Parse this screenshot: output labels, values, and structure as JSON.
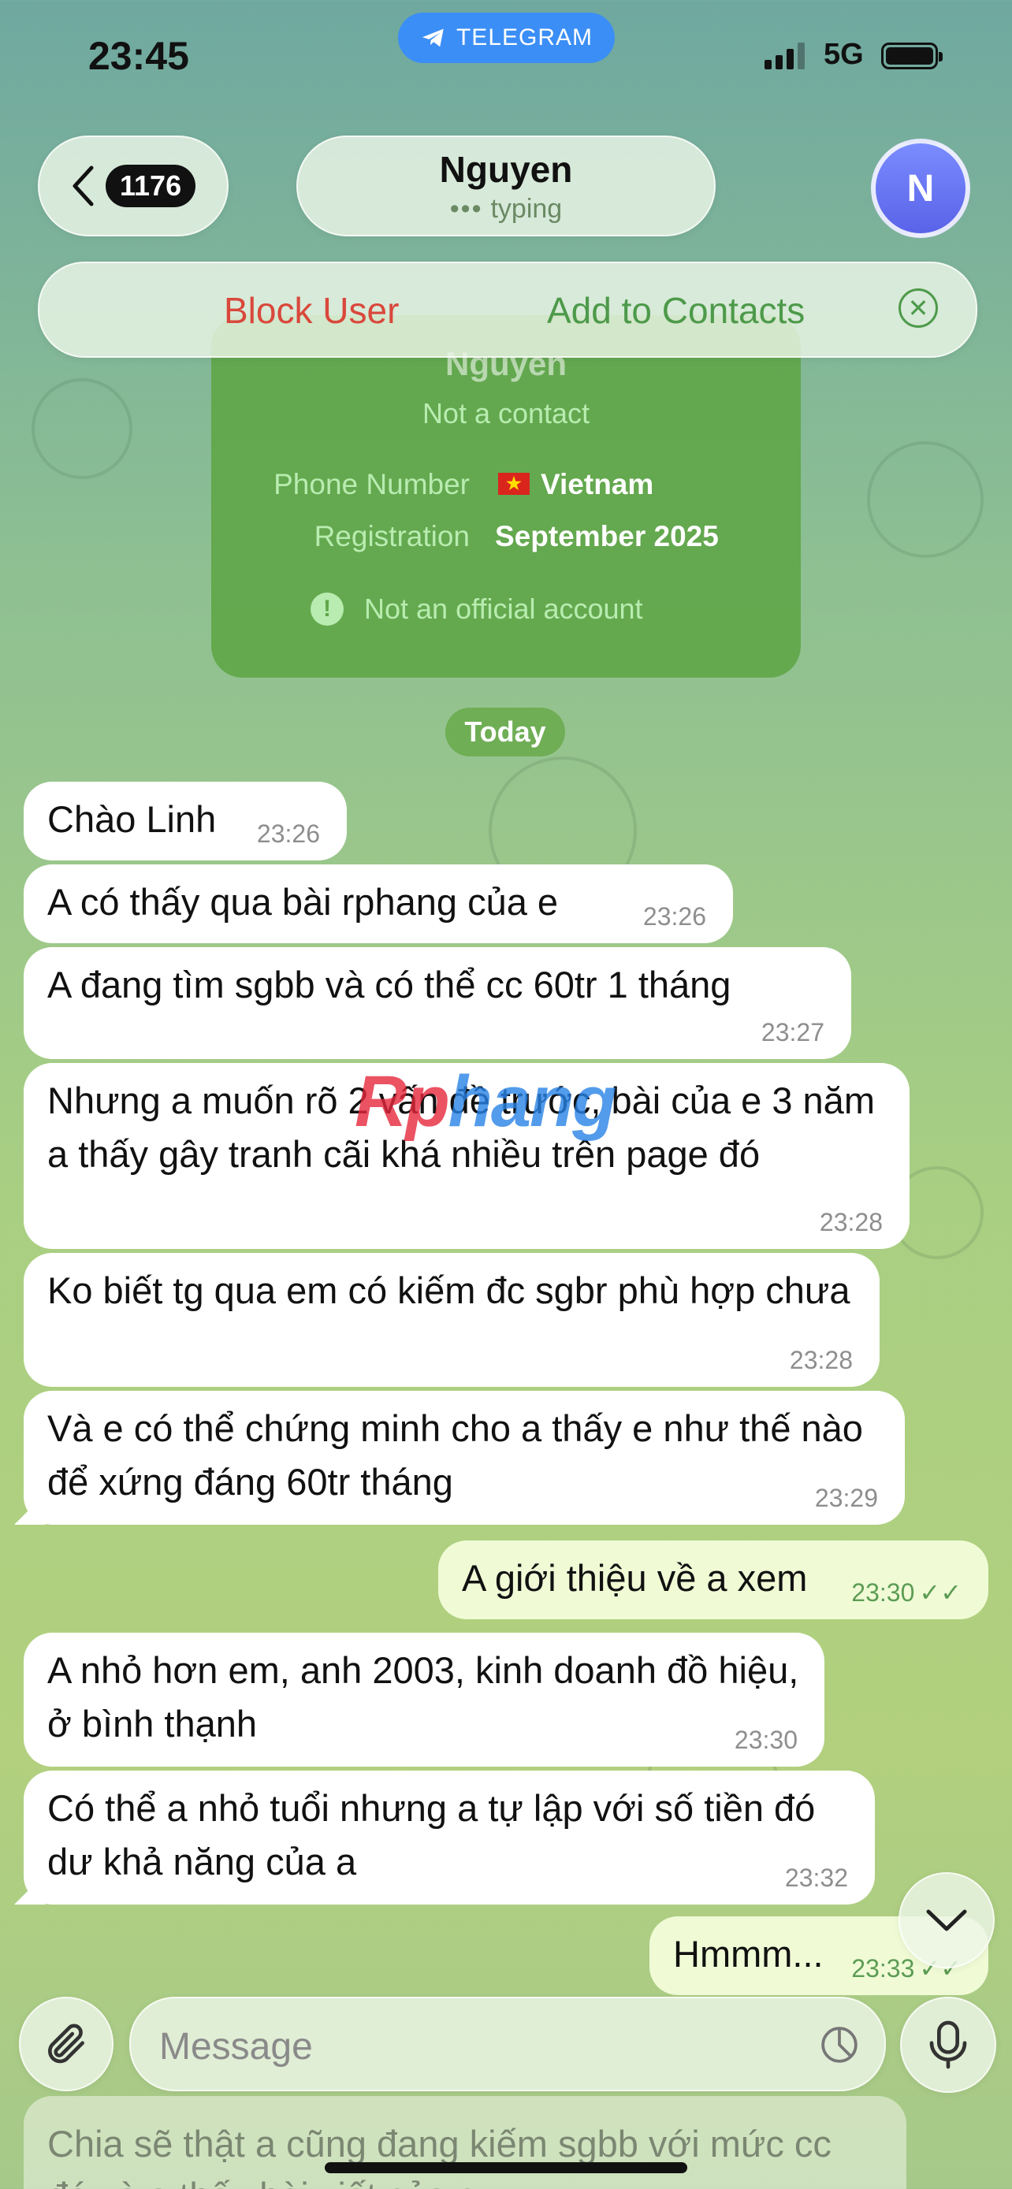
{
  "status_bar": {
    "time": "23:45",
    "app_pill": "TELEGRAM",
    "network": "5G"
  },
  "header": {
    "unread_count": "1176",
    "chat_name": "Nguyen",
    "chat_status": "typing",
    "avatar_initial": "N"
  },
  "action_bar": {
    "block_label": "Block User",
    "add_label": "Add to Contacts"
  },
  "info_card": {
    "name": "Nguyen",
    "subtitle": "Not a contact",
    "phone_label": "Phone Number",
    "phone_value": "Vietnam",
    "registration_label": "Registration",
    "registration_value": "September 2025",
    "warning": "Not an official account"
  },
  "date_divider": "Today",
  "watermark": {
    "part1": "Rp",
    "part2": "hang"
  },
  "messages": [
    {
      "text": "Chào Linh",
      "time": "23:26"
    },
    {
      "text": "A có thấy qua bài rphang của e",
      "time": "23:26"
    },
    {
      "text": "A đang tìm sgbb và có thể cc 60tr 1 tháng",
      "time": "23:27"
    },
    {
      "text": "Nhưng a muốn rõ 2 vấn đề trước, bài của e 3 năm a thấy gây tranh cãi khá nhiều trên page đó",
      "time": "23:28"
    },
    {
      "text": "Ko biết tg qua em có kiếm đc sgbr phù hợp chưa",
      "time": "23:28"
    },
    {
      "text": "Và e có thể chứng minh cho a thấy e như thế nào để xứng đáng 60tr tháng",
      "time": "23:29"
    },
    {
      "text": "A giới thiệu về a xem",
      "time": "23:30"
    },
    {
      "text": "A nhỏ hơn em, anh 2003, kinh doanh đồ hiệu, ở bình thạnh",
      "time": "23:30"
    },
    {
      "text": "Có thể a nhỏ tuổi nhưng a tự lập với số tiền đó dư khả năng của a",
      "time": "23:32"
    },
    {
      "text": "Hmmm...",
      "time": "23:33"
    }
  ],
  "composer": {
    "placeholder": "Message"
  },
  "peek_message": "Chia sẽ thật a cũng đang kiếm sgbb với mức cc đó và a thấy bài viết của e",
  "colors": {
    "block_red": "#d9483b",
    "contact_green": "#4d9a4a",
    "outgoing_bubble": "#f0fbd6",
    "telegram_blue": "#3b8ef5"
  }
}
